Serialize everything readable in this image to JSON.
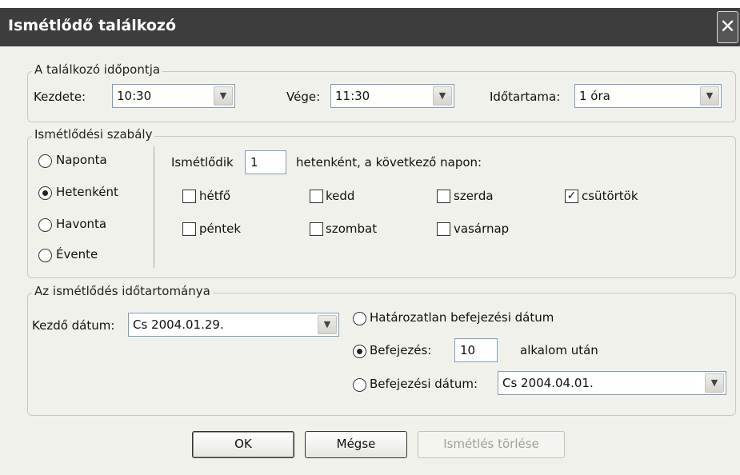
{
  "window": {
    "title": "Ismétlődő találkozó",
    "close_glyph": "✕"
  },
  "time_group": {
    "legend": "A találkozó időpontja",
    "start_label": "Kezdete:",
    "start_value": "10:30",
    "end_label": "Vége:",
    "end_value": "11:30",
    "duration_label": "Időtartama:",
    "duration_value": "1 óra"
  },
  "rule_group": {
    "legend": "Ismétlődési szabály",
    "options": [
      "Naponta",
      "Hetenként",
      "Havonta",
      "Évente"
    ],
    "selected": "Hetenként",
    "repeat_prefix": "Ismétlődik",
    "repeat_value": "1",
    "repeat_suffix": "hetenként, a következő napon:",
    "days": [
      {
        "label": "hétfő",
        "checked": false
      },
      {
        "label": "kedd",
        "checked": false
      },
      {
        "label": "szerda",
        "checked": false
      },
      {
        "label": "csütörtök",
        "checked": true
      },
      {
        "label": "péntek",
        "checked": false
      },
      {
        "label": "szombat",
        "checked": false
      },
      {
        "label": "vasárnap",
        "checked": false
      }
    ]
  },
  "range_group": {
    "legend": "Az ismétlődés időtartománya",
    "start_date_label": "Kezdő dátum:",
    "start_date_value": "Cs 2004.01.29.",
    "no_end_label": "Határozatlan befejezési dátum",
    "end_after_label": "Befejezés:",
    "end_after_value": "10",
    "end_after_suffix": "alkalom után",
    "end_by_label": "Befejezési dátum:",
    "end_by_value": "Cs 2004.04.01.",
    "selected": "end_after"
  },
  "buttons": {
    "ok": "OK",
    "cancel": "Mégse",
    "remove": "Ismétlés törlése"
  },
  "icons": {
    "dropdown": "▼",
    "check": "✓"
  }
}
